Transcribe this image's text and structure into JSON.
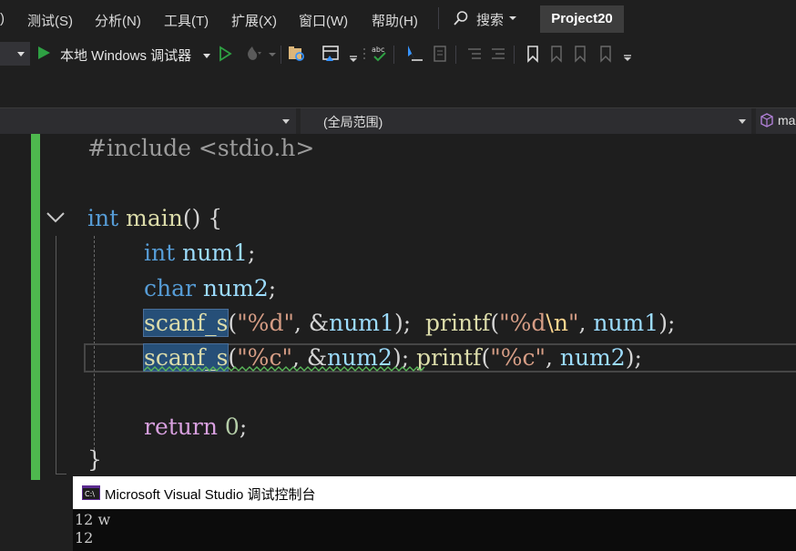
{
  "menu": {
    "items": [
      ")",
      "测试(S)",
      "分析(N)",
      "工具(T)",
      "扩展(X)",
      "窗口(W)",
      "帮助(H)"
    ],
    "search_label": "搜索",
    "project_title": "Project20"
  },
  "toolbar": {
    "run_label": "本地 Windows 调试器"
  },
  "navbar": {
    "scope_label": "(全局范围)",
    "member_label": "ma"
  },
  "code": {
    "line1": {
      "directive": "#include",
      "header": "<stdio.h>"
    },
    "line3": {
      "type": "int",
      "name": "main",
      "rest": "() {"
    },
    "line4": {
      "type": "int",
      "var": "num1",
      "end": ";"
    },
    "line5": {
      "type": "char",
      "var": "num2",
      "end": ";"
    },
    "line6": {
      "fn1": "scanf_s",
      "p1": "(",
      "s1": "\"%d\"",
      "c1": ", &",
      "v1": "num1",
      "e1": ");",
      "fn2": "printf",
      "p2": "(",
      "s2a": "\"%d",
      "s2esc": "\\n",
      "s2b": "\"",
      "c2": ", ",
      "v2": "num1",
      "e2": ");"
    },
    "line7": {
      "fn1": "scanf_s",
      "p1": "(",
      "s1": "\"%c\"",
      "c1": ", &",
      "v1": "num2",
      "e1": ");",
      "fn2": "printf",
      "p2": "(",
      "s2": "\"%c\"",
      "c2": ", ",
      "v2": "num2",
      "e2": ");"
    },
    "line9": {
      "kw": "return",
      "val": "0",
      "end": ";"
    },
    "line10": {
      "brace": "}"
    }
  },
  "console": {
    "title": "Microsoft Visual Studio 调试控制台",
    "output": [
      "12 w",
      "12"
    ]
  },
  "colors": {
    "change_bar": "#4eb84e",
    "keyword": "#569cd6",
    "function": "#dcdcaa",
    "variable": "#9cdcfe",
    "string": "#d69d85",
    "number": "#b5cea8"
  }
}
